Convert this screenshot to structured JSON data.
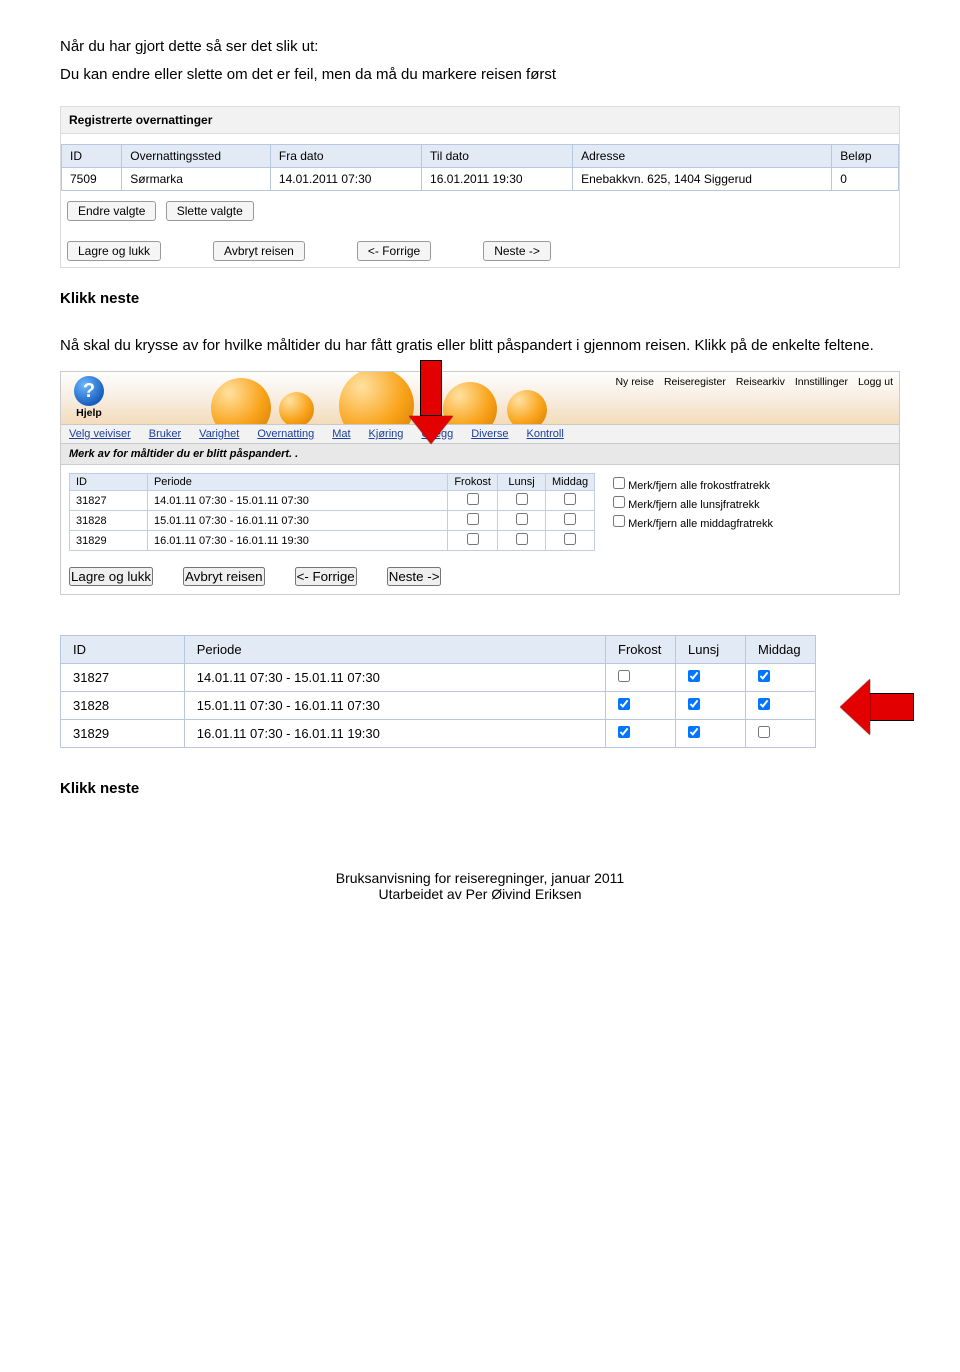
{
  "intro": {
    "line1": "Når du har gjort dette så ser det slik ut:",
    "line2": "Du kan endre eller slette om det er feil, men da må du markere reisen først"
  },
  "panel1": {
    "title": "Registrerte overnattinger",
    "headers": {
      "id": "ID",
      "sted": "Overnattingssted",
      "fra": "Fra dato",
      "til": "Til dato",
      "adresse": "Adresse",
      "belop": "Beløp"
    },
    "row": {
      "id": "7509",
      "sted": "Sørmarka",
      "fra": "14.01.2011 07:30",
      "til": "16.01.2011 19:30",
      "adresse": "Enebakkvn. 625, 1404 Siggerud",
      "belop": "0"
    },
    "btn_edit": "Endre valgte",
    "btn_delete": "Slette valgte",
    "nav": {
      "save": "Lagre og lukk",
      "abort": "Avbryt reisen",
      "prev": "<- Forrige",
      "next": "Neste ->"
    }
  },
  "klikk_neste": "Klikk neste",
  "mid_para": "Nå skal du krysse av for hvilke måltider du har fått gratis eller blitt påspandert i gjennom reisen. Klikk på de enkelte feltene.",
  "app": {
    "topnav": {
      "nyreise": "Ny reise",
      "reg": "Reiseregister",
      "arkiv": "Reisearkiv",
      "inst": "Innstillinger",
      "logout": "Logg ut"
    },
    "help": "Hjelp",
    "wizard": {
      "velg": "Velg veiviser",
      "bruker": "Bruker",
      "varighet": "Varighet",
      "overnatting": "Overnatting",
      "mat": "Mat",
      "kjoring": "Kjøring",
      "utlegg": "Utlegg",
      "diverse": "Diverse",
      "kontroll": "Kontroll"
    },
    "subhead": "Merk av for måltider du er blitt påspandert. .",
    "headers": {
      "id": "ID",
      "periode": "Periode",
      "frokost": "Frokost",
      "lunsj": "Lunsj",
      "middag": "Middag"
    },
    "rows": [
      {
        "id": "31827",
        "periode": "14.01.11 07:30 - 15.01.11 07:30",
        "frokost": false,
        "lunsj": false,
        "middag": false
      },
      {
        "id": "31828",
        "periode": "15.01.11 07:30 - 16.01.11 07:30",
        "frokost": false,
        "lunsj": false,
        "middag": false
      },
      {
        "id": "31829",
        "periode": "16.01.11 07:30 - 16.01.11 19:30",
        "frokost": false,
        "lunsj": false,
        "middag": false
      }
    ],
    "opts": {
      "a": "Merk/fjern alle frokostfratrekk",
      "b": "Merk/fjern alle lunsjfratrekk",
      "c": "Merk/fjern alle middagfratrekk"
    },
    "footer": {
      "save": "Lagre og lukk",
      "abort": "Avbryt reisen",
      "prev": "<- Forrige",
      "next": "Neste ->"
    }
  },
  "big": {
    "headers": {
      "id": "ID",
      "periode": "Periode",
      "frokost": "Frokost",
      "lunsj": "Lunsj",
      "middag": "Middag"
    },
    "rows": [
      {
        "id": "31827",
        "periode": "14.01.11 07:30 - 15.01.11 07:30",
        "frokost": false,
        "lunsj": true,
        "middag": true
      },
      {
        "id": "31828",
        "periode": "15.01.11 07:30 - 16.01.11 07:30",
        "frokost": true,
        "lunsj": true,
        "middag": true
      },
      {
        "id": "31829",
        "periode": "16.01.11 07:30 - 16.01.11 19:30",
        "frokost": true,
        "lunsj": true,
        "middag": false
      }
    ]
  },
  "footer": {
    "l1": "Bruksanvisning for reiseregninger, januar 2011",
    "l2": "Utarbeidet av Per Øivind Eriksen"
  }
}
